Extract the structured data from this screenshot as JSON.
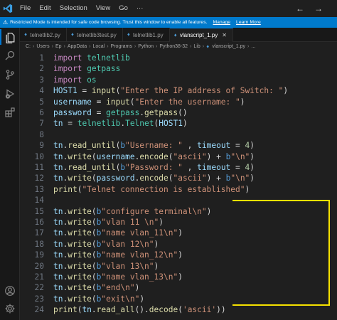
{
  "menu": {
    "file": "File",
    "edit": "Edit",
    "selection": "Selection",
    "view": "View",
    "go": "Go",
    "more": "···"
  },
  "banner": {
    "text": "Restricted Mode is intended for safe code browsing. Trust this window to enable all features.",
    "manage": "Manage",
    "learn_more": "Learn More"
  },
  "tabs": [
    {
      "label": "telnetlib2.py",
      "active": false
    },
    {
      "label": "telnetlib3test.py",
      "active": false
    },
    {
      "label": "telnetlib1.py",
      "active": false
    },
    {
      "label": "vlanscript_1.py",
      "active": true
    }
  ],
  "breadcrumb": [
    "C:",
    "Users",
    "Ep",
    "AppData",
    "Local",
    "Programs",
    "Python",
    "Python38-32",
    "Lib",
    "vlanscript_1.py",
    "..."
  ],
  "editor": {
    "lines": [
      {
        "n": "1",
        "t": [
          [
            "kw",
            "import"
          ],
          [
            "op",
            " "
          ],
          [
            "cls",
            "telnetlib"
          ]
        ]
      },
      {
        "n": "2",
        "t": [
          [
            "kw",
            "import"
          ],
          [
            "op",
            " "
          ],
          [
            "cls",
            "getpass"
          ]
        ]
      },
      {
        "n": "3",
        "t": [
          [
            "kw",
            "import"
          ],
          [
            "op",
            " "
          ],
          [
            "cls",
            "os"
          ]
        ]
      },
      {
        "n": "4",
        "t": [
          [
            "id",
            "HOST1"
          ],
          [
            "op",
            " = "
          ],
          [
            "fn",
            "input"
          ],
          [
            "op",
            "("
          ],
          [
            "str",
            "\"Enter the IP address of Switch: \""
          ],
          [
            "op",
            ")"
          ]
        ]
      },
      {
        "n": "5",
        "t": [
          [
            "id",
            "username"
          ],
          [
            "op",
            " = "
          ],
          [
            "fn",
            "input"
          ],
          [
            "op",
            "("
          ],
          [
            "str",
            "\"Enter the username: \""
          ],
          [
            "op",
            ")"
          ]
        ]
      },
      {
        "n": "6",
        "t": [
          [
            "id",
            "password"
          ],
          [
            "op",
            " = "
          ],
          [
            "cls",
            "getpass"
          ],
          [
            "op",
            "."
          ],
          [
            "fn",
            "getpass"
          ],
          [
            "op",
            "()"
          ]
        ]
      },
      {
        "n": "7",
        "t": [
          [
            "id",
            "tn"
          ],
          [
            "op",
            " = "
          ],
          [
            "cls",
            "telnetlib"
          ],
          [
            "op",
            "."
          ],
          [
            "cls",
            "Telnet"
          ],
          [
            "op",
            "("
          ],
          [
            "id",
            "HOST1"
          ],
          [
            "op",
            ")"
          ]
        ]
      },
      {
        "n": "8",
        "t": []
      },
      {
        "n": "9",
        "t": [
          [
            "id",
            "tn"
          ],
          [
            "op",
            "."
          ],
          [
            "fn",
            "read_until"
          ],
          [
            "op",
            "("
          ],
          [
            "pref",
            "b"
          ],
          [
            "str",
            "\"Username: \""
          ],
          [
            "op",
            " , "
          ],
          [
            "id",
            "timeout"
          ],
          [
            "op",
            " = "
          ],
          [
            "num",
            "4"
          ],
          [
            "op",
            ")"
          ]
        ]
      },
      {
        "n": "10",
        "t": [
          [
            "id",
            "tn"
          ],
          [
            "op",
            "."
          ],
          [
            "fn",
            "write"
          ],
          [
            "op",
            "("
          ],
          [
            "id",
            "username"
          ],
          [
            "op",
            "."
          ],
          [
            "fn",
            "encode"
          ],
          [
            "op",
            "("
          ],
          [
            "str",
            "\"ascii\""
          ],
          [
            "op",
            ") + "
          ],
          [
            "pref",
            "b"
          ],
          [
            "str",
            "\"\\n\""
          ],
          [
            "op",
            ")"
          ]
        ]
      },
      {
        "n": "11",
        "t": [
          [
            "id",
            "tn"
          ],
          [
            "op",
            "."
          ],
          [
            "fn",
            "read_until"
          ],
          [
            "op",
            "("
          ],
          [
            "pref",
            "b"
          ],
          [
            "str",
            "\"Password: \""
          ],
          [
            "op",
            " , "
          ],
          [
            "id",
            "timeout"
          ],
          [
            "op",
            " = "
          ],
          [
            "num",
            "4"
          ],
          [
            "op",
            ")"
          ]
        ]
      },
      {
        "n": "12",
        "t": [
          [
            "id",
            "tn"
          ],
          [
            "op",
            "."
          ],
          [
            "fn",
            "write"
          ],
          [
            "op",
            "("
          ],
          [
            "id",
            "password"
          ],
          [
            "op",
            "."
          ],
          [
            "fn",
            "encode"
          ],
          [
            "op",
            "("
          ],
          [
            "str",
            "\"ascii\""
          ],
          [
            "op",
            ") + "
          ],
          [
            "pref",
            "b"
          ],
          [
            "str",
            "\"\\n\""
          ],
          [
            "op",
            ")"
          ]
        ]
      },
      {
        "n": "13",
        "t": [
          [
            "fn",
            "print"
          ],
          [
            "op",
            "("
          ],
          [
            "str",
            "\"Telnet connection is established\""
          ],
          [
            "op",
            ")"
          ]
        ]
      },
      {
        "n": "14",
        "t": []
      },
      {
        "n": "15",
        "t": [
          [
            "id",
            "tn"
          ],
          [
            "op",
            "."
          ],
          [
            "fn",
            "write"
          ],
          [
            "op",
            "("
          ],
          [
            "pref",
            "b"
          ],
          [
            "str",
            "\"configure terminal\\n\""
          ],
          [
            "op",
            ")"
          ]
        ]
      },
      {
        "n": "16",
        "t": [
          [
            "id",
            "tn"
          ],
          [
            "op",
            "."
          ],
          [
            "fn",
            "write"
          ],
          [
            "op",
            "("
          ],
          [
            "pref",
            "b"
          ],
          [
            "str",
            "\"vlan 11 \\n\""
          ],
          [
            "op",
            ")"
          ]
        ]
      },
      {
        "n": "17",
        "t": [
          [
            "id",
            "tn"
          ],
          [
            "op",
            "."
          ],
          [
            "fn",
            "write"
          ],
          [
            "op",
            "("
          ],
          [
            "pref",
            "b"
          ],
          [
            "str",
            "\"name vlan_11\\n\""
          ],
          [
            "op",
            ")"
          ]
        ]
      },
      {
        "n": "18",
        "t": [
          [
            "id",
            "tn"
          ],
          [
            "op",
            "."
          ],
          [
            "fn",
            "write"
          ],
          [
            "op",
            "("
          ],
          [
            "pref",
            "b"
          ],
          [
            "str",
            "\"vlan 12\\n\""
          ],
          [
            "op",
            ")"
          ]
        ]
      },
      {
        "n": "19",
        "t": [
          [
            "id",
            "tn"
          ],
          [
            "op",
            "."
          ],
          [
            "fn",
            "write"
          ],
          [
            "op",
            "("
          ],
          [
            "pref",
            "b"
          ],
          [
            "str",
            "\"name vlan_12\\n\""
          ],
          [
            "op",
            ")"
          ]
        ]
      },
      {
        "n": "20",
        "t": [
          [
            "id",
            "tn"
          ],
          [
            "op",
            "."
          ],
          [
            "fn",
            "write"
          ],
          [
            "op",
            "("
          ],
          [
            "pref",
            "b"
          ],
          [
            "str",
            "\"vlan 13\\n\""
          ],
          [
            "op",
            ")"
          ]
        ]
      },
      {
        "n": "21",
        "t": [
          [
            "id",
            "tn"
          ],
          [
            "op",
            "."
          ],
          [
            "fn",
            "write"
          ],
          [
            "op",
            "("
          ],
          [
            "pref",
            "b"
          ],
          [
            "str",
            "\"name vlan_13\\n\""
          ],
          [
            "op",
            ")"
          ]
        ]
      },
      {
        "n": "22",
        "t": [
          [
            "id",
            "tn"
          ],
          [
            "op",
            "."
          ],
          [
            "fn",
            "write"
          ],
          [
            "op",
            "("
          ],
          [
            "pref",
            "b"
          ],
          [
            "str",
            "\"end\\n\""
          ],
          [
            "op",
            ")"
          ]
        ]
      },
      {
        "n": "23",
        "t": [
          [
            "id",
            "tn"
          ],
          [
            "op",
            "."
          ],
          [
            "fn",
            "write"
          ],
          [
            "op",
            "("
          ],
          [
            "pref",
            "b"
          ],
          [
            "str",
            "\"exit\\n\""
          ],
          [
            "op",
            ")"
          ]
        ]
      },
      {
        "n": "24",
        "t": [
          [
            "fn",
            "print"
          ],
          [
            "op",
            "("
          ],
          [
            "id",
            "tn"
          ],
          [
            "op",
            "."
          ],
          [
            "fn",
            "read_all"
          ],
          [
            "op",
            "()."
          ],
          [
            "fn",
            "decode"
          ],
          [
            "op",
            "("
          ],
          [
            "str",
            "'ascii'"
          ],
          [
            "op",
            "))"
          ]
        ]
      }
    ]
  },
  "colors": {
    "accent": "#0078d4",
    "banner": "#007acc",
    "highlight": "#f5e100"
  },
  "icons": [
    "explorer-icon",
    "search-icon",
    "source-control-icon",
    "run-debug-icon",
    "extensions-icon",
    "account-icon",
    "settings-icon"
  ]
}
